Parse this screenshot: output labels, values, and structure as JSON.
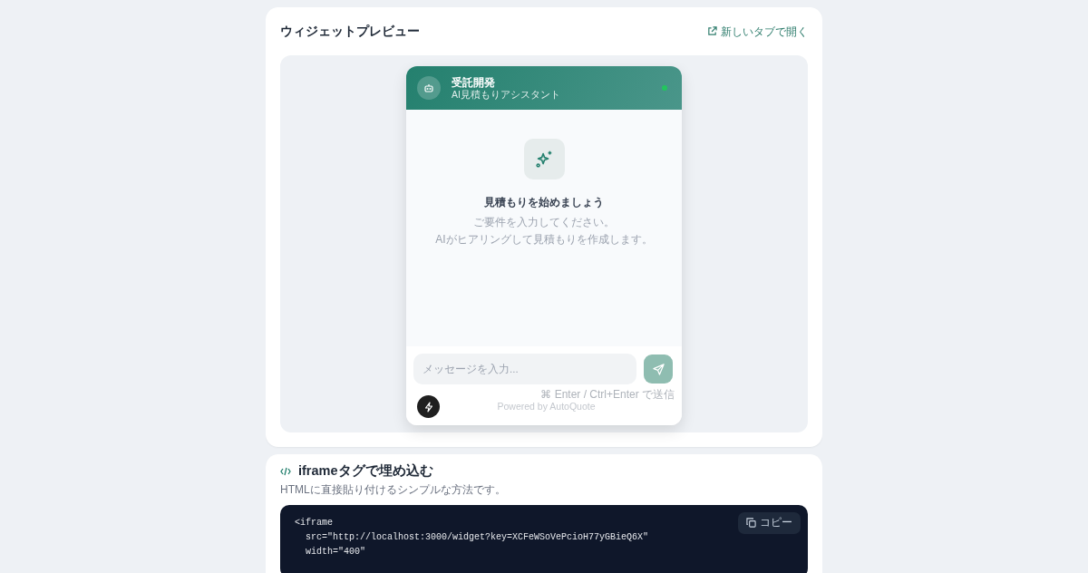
{
  "preview": {
    "title": "ウィジェットプレビュー",
    "open_link": "新しいタブで開く",
    "widget": {
      "name": "受託開発",
      "subtitle": "AI見積もりアシスタント",
      "empty_title": "見積もりを始めましょう",
      "empty_lines": [
        "ご要件を入力してください。",
        "AIがヒアリングして見積もりを作成します。"
      ],
      "input": {
        "placeholder": "メッセージを入力..."
      },
      "hint": "⌘ Enter / Ctrl+Enter で送信",
      "powered_by": "Powered by AutoQuote"
    }
  },
  "iframe_section": {
    "title": "iframeタグで埋め込む",
    "description": "HTMLに直接貼り付けるシンプルな方法です。",
    "copy_label": "コピー",
    "code_lines": [
      "<iframe",
      "  src=\"http://localhost:3000/widget?key=XCFeWSoVePcioH77yGBieQ6X\"",
      "  width=\"400\""
    ]
  }
}
